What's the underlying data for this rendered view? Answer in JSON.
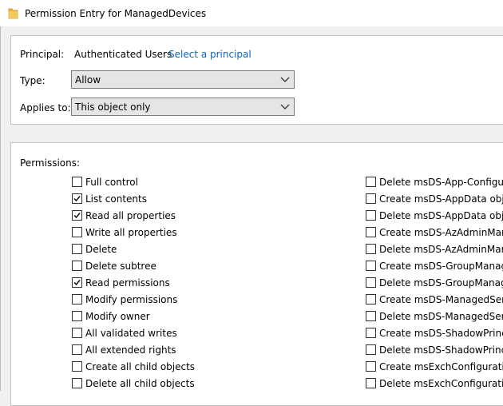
{
  "window": {
    "title": "Permission Entry for ManagedDevices"
  },
  "principal": {
    "label": "Principal:",
    "value": "Authenticated Users",
    "select_link": "Select a principal"
  },
  "type": {
    "label": "Type:",
    "value": "Allow"
  },
  "applies_to": {
    "label": "Applies to:",
    "value": "This object only"
  },
  "permissions": {
    "label": "Permissions:",
    "left": [
      {
        "label": "Full control",
        "checked": false
      },
      {
        "label": "List contents",
        "checked": true
      },
      {
        "label": "Read all properties",
        "checked": true
      },
      {
        "label": "Write all properties",
        "checked": false
      },
      {
        "label": "Delete",
        "checked": false
      },
      {
        "label": "Delete subtree",
        "checked": false
      },
      {
        "label": "Read permissions",
        "checked": true
      },
      {
        "label": "Modify permissions",
        "checked": false
      },
      {
        "label": "Modify owner",
        "checked": false
      },
      {
        "label": "All validated writes",
        "checked": false
      },
      {
        "label": "All extended rights",
        "checked": false
      },
      {
        "label": "Create all child objects",
        "checked": false
      },
      {
        "label": "Delete all child objects",
        "checked": false
      }
    ],
    "right": [
      {
        "label": "Delete msDS-App-Configurat",
        "checked": false
      },
      {
        "label": "Create msDS-AppData object",
        "checked": false
      },
      {
        "label": "Delete msDS-AppData objects",
        "checked": false
      },
      {
        "label": "Create msDS-AzAdminManag",
        "checked": false
      },
      {
        "label": "Delete msDS-AzAdminManag",
        "checked": false
      },
      {
        "label": "Create msDS-GroupManaged",
        "checked": false
      },
      {
        "label": "Delete msDS-GroupManagedS",
        "checked": false
      },
      {
        "label": "Create msDS-ManagedService",
        "checked": false
      },
      {
        "label": "Delete msDS-ManagedService",
        "checked": false
      },
      {
        "label": "Create msDS-ShadowPrincipa",
        "checked": false
      },
      {
        "label": "Delete msDS-ShadowPrincipa",
        "checked": false
      },
      {
        "label": "Create msExchConfigurationC",
        "checked": false
      },
      {
        "label": "Delete msExchConfigurationC",
        "checked": false
      }
    ]
  },
  "icons": {
    "title_icon": "folder-icon",
    "combo_arrow": "chevron-down-icon",
    "check_mark": "checkmark-icon"
  },
  "colors": {
    "link": "#0b63c9",
    "folder": "#e8b339"
  }
}
